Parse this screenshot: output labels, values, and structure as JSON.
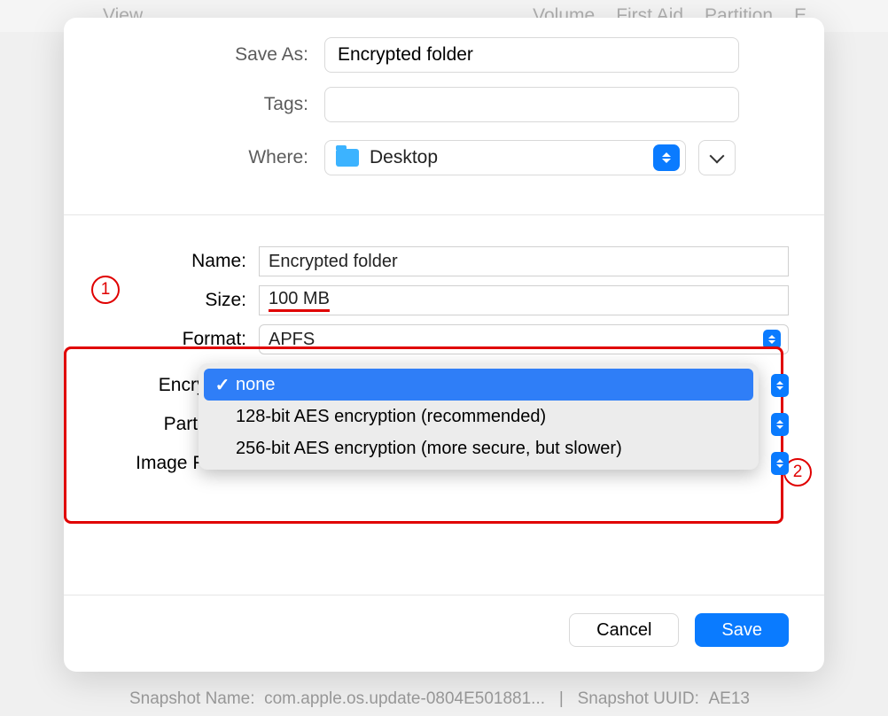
{
  "bg_toolbar": {
    "left": "View",
    "items": [
      "Volume",
      "First Aid",
      "Partition",
      "E"
    ]
  },
  "bg_bottom": {
    "snap_name_label": "Snapshot Name:",
    "snap_name": "com.apple.os.update-0804E501881...",
    "snap_uuid_label": "Snapshot UUID:",
    "snap_uuid": "AE13"
  },
  "save": {
    "save_as_label": "Save As:",
    "save_as_value": "Encrypted folder",
    "tags_label": "Tags:",
    "tags_value": "",
    "where_label": "Where:",
    "where_value": "Desktop"
  },
  "form": {
    "name_label": "Name:",
    "name_value": "Encrypted folder",
    "size_label": "Size:",
    "size_value": "100 MB",
    "format_label": "Format:",
    "format_value": "APFS",
    "encryption_label": "Encryption",
    "partitions_label": "Partitions:",
    "image_format_label": "Image Forma"
  },
  "menu": {
    "selected": "none",
    "options": [
      "none",
      "128-bit AES encryption (recommended)",
      "256-bit AES encryption (more secure, but slower)"
    ]
  },
  "buttons": {
    "cancel": "Cancel",
    "save": "Save"
  },
  "annotations": {
    "one": "1",
    "two": "2"
  }
}
